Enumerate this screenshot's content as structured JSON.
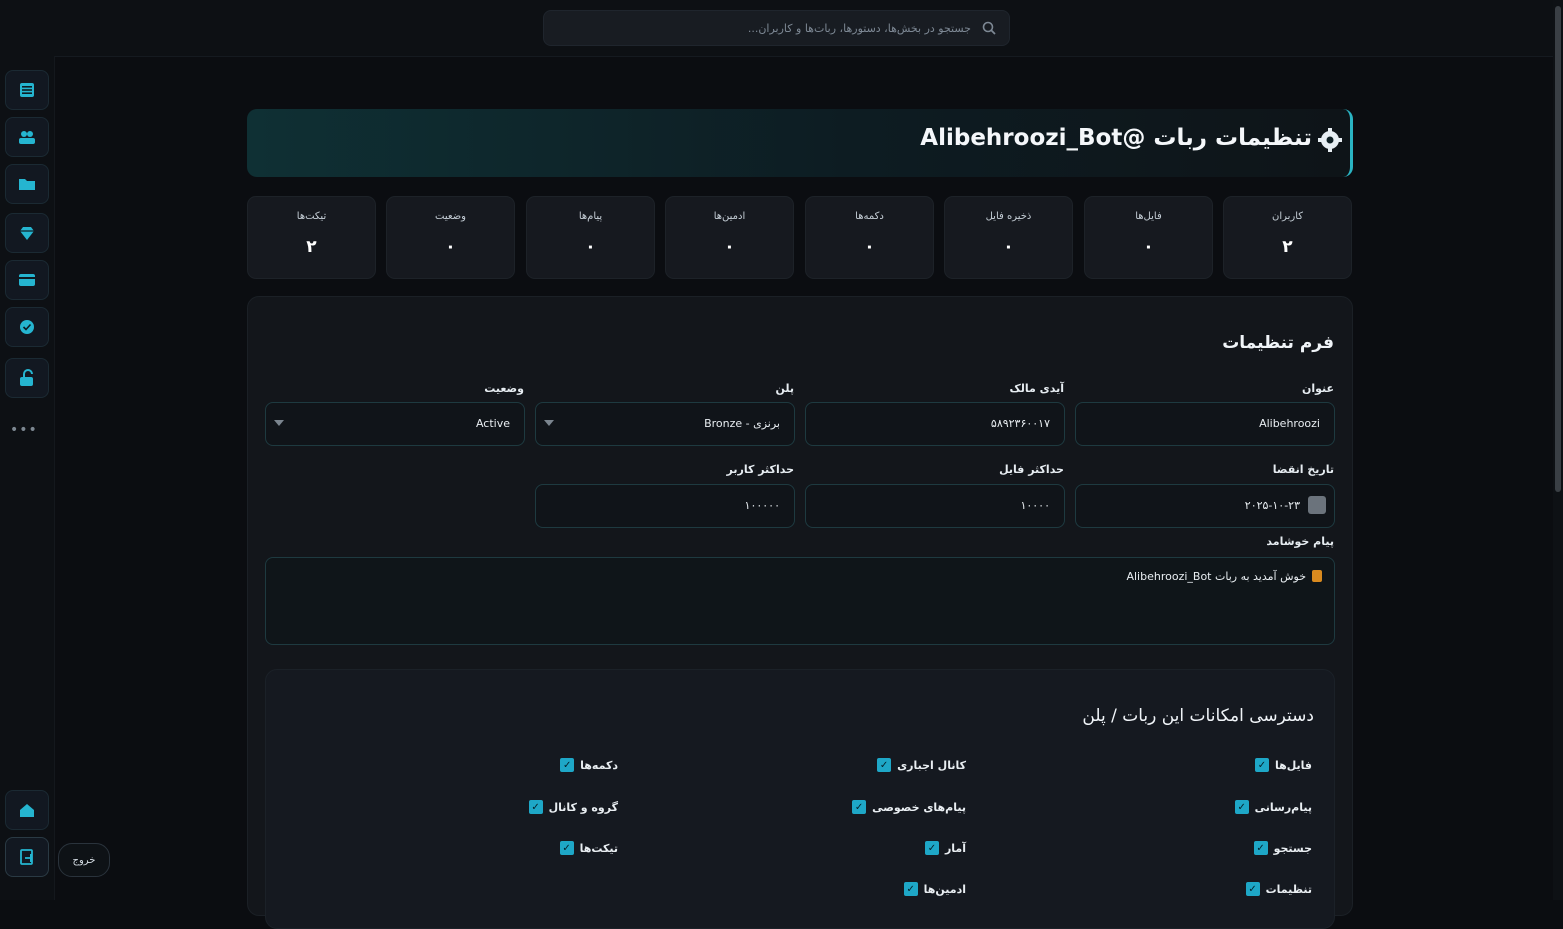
{
  "search": {
    "placeholder": "جستجو در بخش‌ها، دستورها، ربات‌ها و کاربران..."
  },
  "header": {
    "title": "تنظیمات ربات @Alibehroozi_Bot"
  },
  "stats": [
    {
      "label": "کاربران",
      "value": "۲"
    },
    {
      "label": "فایل‌ها",
      "value": "۰"
    },
    {
      "label": "ذخیره فایل",
      "value": "۰"
    },
    {
      "label": "دکمه‌ها",
      "value": "۰"
    },
    {
      "label": "ادمین‌ها",
      "value": "۰"
    },
    {
      "label": "پیام‌ها",
      "value": "۰"
    },
    {
      "label": "وضعیت",
      "value": "۰"
    },
    {
      "label": "تیکت‌ها",
      "value": "۲"
    }
  ],
  "form": {
    "title": "فرم تنظیمات",
    "labels": {
      "name": "عنوان",
      "owner": "آیدی مالک",
      "plan": "پلن",
      "status": "وضعیت",
      "expire": "تاریخ انقضا",
      "max_files": "حداکثر فایل",
      "max_users": "حداکثر کاربر",
      "welcome": "پیام خوشامد"
    },
    "values": {
      "name": "Alibehroozi",
      "owner": "۵۸۹۲۳۶۰۰۱۷",
      "plan": "برنزی - Bronze",
      "status": "Active",
      "expire": "۲۰۲۵-۱۰-۲۳",
      "max_files": "۱۰۰۰۰",
      "max_users": "۱۰۰۰۰۰"
    },
    "welcome_text": "خوش آمدید به ربات Alibehroozi_Bot"
  },
  "permissions": {
    "title": "دسترسی امکانات این ربات / پلن",
    "items": [
      {
        "label": "فایل‌ها",
        "checked": true
      },
      {
        "label": "کانال اجباری",
        "checked": true
      },
      {
        "label": "دکمه‌ها",
        "checked": true
      },
      {
        "label": "پیام‌رسانی",
        "checked": true
      },
      {
        "label": "پیام‌های خصوصی",
        "checked": true
      },
      {
        "label": "گروه و کانال",
        "checked": true
      },
      {
        "label": "جستجو",
        "checked": true
      },
      {
        "label": "آمار",
        "checked": true
      },
      {
        "label": "تیکت‌ها",
        "checked": true
      },
      {
        "label": "تنظیمات",
        "checked": true
      },
      {
        "label": "ادمین‌ها",
        "checked": true
      }
    ]
  },
  "sidebar": {
    "items": [
      "menu-icon",
      "users-icon",
      "folder-icon",
      "diamond-icon",
      "card-icon",
      "check-icon",
      "unlock-icon"
    ],
    "more": "•••",
    "home": "home-icon",
    "logout": "logout-icon",
    "logout_tooltip": "خروج"
  },
  "colors": {
    "accent": "#1ea7c7",
    "background": "#0b0d11",
    "card": "#16191f"
  }
}
